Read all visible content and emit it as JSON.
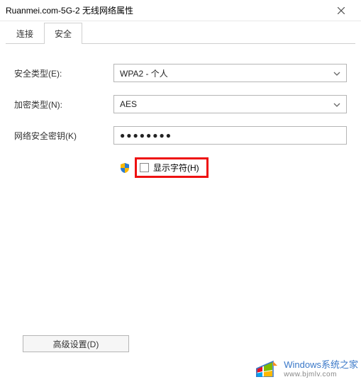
{
  "window": {
    "title": "Ruanmei.com-5G-2 无线网络属性"
  },
  "tabs": {
    "connection": "连接",
    "security": "安全"
  },
  "fields": {
    "securityType": {
      "label": "安全类型(E):",
      "value": "WPA2 - 个人"
    },
    "encryptionType": {
      "label": "加密类型(N):",
      "value": "AES"
    },
    "networkKey": {
      "label": "网络安全密钥(K)",
      "value": "●●●●●●●●"
    },
    "showChars": {
      "label": "显示字符(H)"
    }
  },
  "buttons": {
    "advanced": "高级设置(D)"
  },
  "watermark": {
    "brand": "Windows系统之家",
    "url": "www.bjmlv.com"
  }
}
